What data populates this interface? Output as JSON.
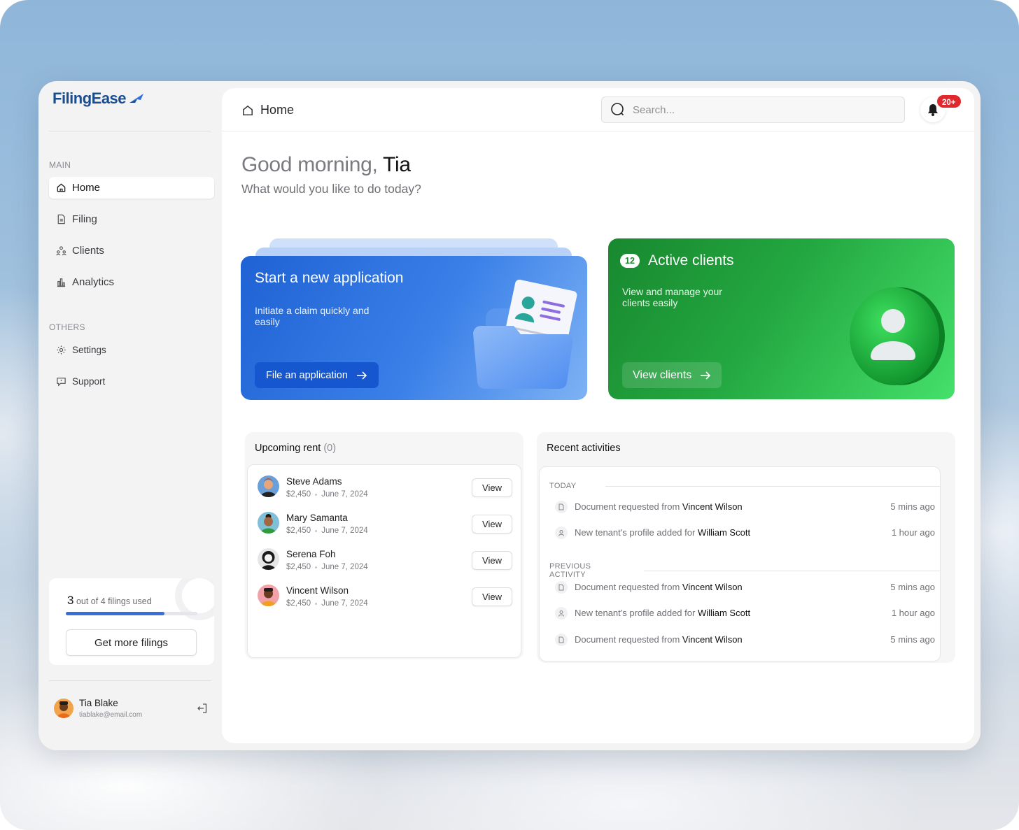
{
  "app": {
    "logo_text": "FilingEase"
  },
  "sidebar": {
    "main_label": "MAIN",
    "others_label": "OTHERS",
    "main_items": [
      {
        "label": "Home",
        "icon": "home-icon"
      },
      {
        "label": "Filing",
        "icon": "file-icon"
      },
      {
        "label": "Clients",
        "icon": "users-icon"
      },
      {
        "label": "Analytics",
        "icon": "bar-chart-icon"
      }
    ],
    "other_items": [
      {
        "label": "Settings",
        "icon": "gear-icon"
      },
      {
        "label": "Support",
        "icon": "chat-icon"
      }
    ],
    "usage": {
      "used": "3",
      "text": "out of 4 filings used",
      "fraction": 0.75,
      "button": "Get more filings"
    },
    "user": {
      "name": "Tia Blake",
      "email": "tiablake@email.com"
    }
  },
  "header": {
    "breadcrumb": "Home",
    "search_placeholder": "Search...",
    "notification_badge": "20+"
  },
  "greeting": {
    "prefix": "Good morning,",
    "name": "Tia",
    "subtitle": "What would you like to do today?"
  },
  "cards": {
    "application": {
      "title": "Start a new application",
      "description": "Initiate a claim quickly and easily",
      "button": "File an application",
      "color": "#1f62d4"
    },
    "clients": {
      "count": "12",
      "title": "Active clients",
      "description": "View and manage your clients easily",
      "button": "View clients",
      "color": "#23a740"
    }
  },
  "upcoming_rent": {
    "title": "Upcoming rent",
    "count": "(0)",
    "view_label": "View",
    "rows": [
      {
        "name": "Steve Adams",
        "amount": "$2,450",
        "date": "June 7, 2024"
      },
      {
        "name": "Mary Samanta",
        "amount": "$2,450",
        "date": "June 7, 2024"
      },
      {
        "name": "Serena Foh",
        "amount": "$2,450",
        "date": "June 7, 2024"
      },
      {
        "name": "Vincent Wilson",
        "amount": "$2,450",
        "date": "June 7, 2024"
      }
    ]
  },
  "activities": {
    "title": "Recent activities",
    "today_label": "TODAY",
    "previous_label": "PREVIOUS ACTIVITY",
    "today": [
      {
        "icon": "document-icon",
        "text": "Document requested from",
        "who": "Vincent Wilson",
        "time": "5 mins ago"
      },
      {
        "icon": "user-icon",
        "text": "New tenant's profile added for",
        "who": "William Scott",
        "time": "1 hour ago"
      }
    ],
    "previous": [
      {
        "icon": "document-icon",
        "text": "Document requested from",
        "who": "Vincent Wilson",
        "time": "5 mins ago"
      },
      {
        "icon": "user-icon",
        "text": "New tenant's profile added for",
        "who": "William Scott",
        "time": "1 hour ago"
      },
      {
        "icon": "document-icon",
        "text": "Document requested from",
        "who": "Vincent Wilson",
        "time": "5 mins ago"
      }
    ]
  }
}
